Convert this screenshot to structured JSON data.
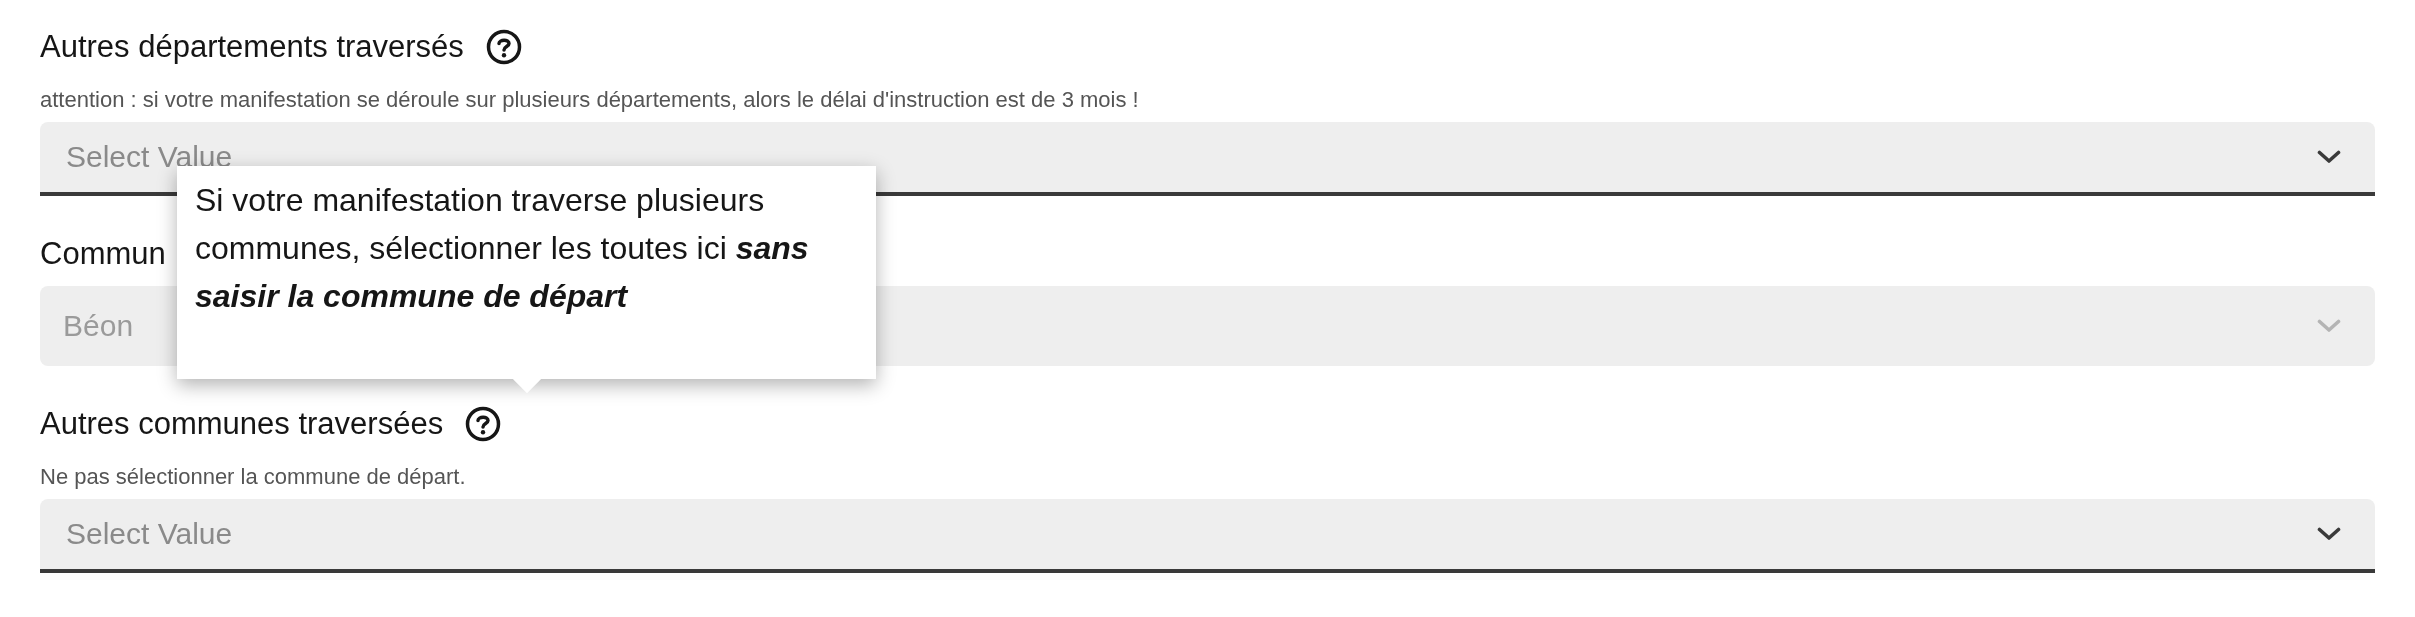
{
  "fields": [
    {
      "label": "Autres départements traversés",
      "help": true,
      "hint": "attention : si votre manifestation se déroule sur plusieurs départements, alors le délai d'instruction est de 3 mois !",
      "select": {
        "placeholder": "Select Value",
        "disabled": false
      }
    },
    {
      "label": "Commun",
      "help": false,
      "select": {
        "value": "Béon",
        "disabled": true
      }
    },
    {
      "label": "Autres communes traversées",
      "help": true,
      "hint": "Ne pas sélectionner la commune de départ.",
      "select": {
        "placeholder": "Select Value",
        "disabled": false
      }
    }
  ],
  "tooltip": {
    "text": "Si votre manifestation traverse plusieurs communes, sélectionner les toutes ici **sans saisir la commune de départ**"
  }
}
